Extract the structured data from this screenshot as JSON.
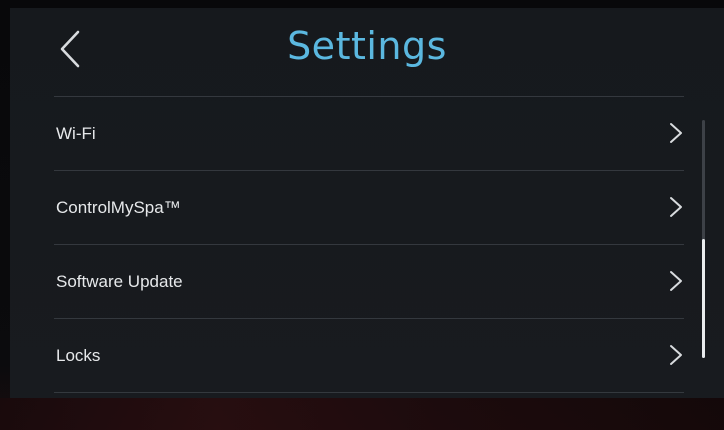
{
  "header": {
    "title": "Settings",
    "back_icon": "chevron-left-icon"
  },
  "colors": {
    "accent": "#5bb8e0",
    "background": "#171a1e",
    "divider": "#3a3e44",
    "text": "#e6e8ea"
  },
  "menu": {
    "items": [
      {
        "label": "Wi-Fi",
        "icon": "chevron-right-icon"
      },
      {
        "label": "ControlMySpa™",
        "icon": "chevron-right-icon"
      },
      {
        "label": "Software Update",
        "icon": "chevron-right-icon"
      },
      {
        "label": "Locks",
        "icon": "chevron-right-icon"
      }
    ]
  },
  "scrollbar": {
    "thumb_start_fraction": 0.5,
    "thumb_length_fraction": 0.5
  }
}
